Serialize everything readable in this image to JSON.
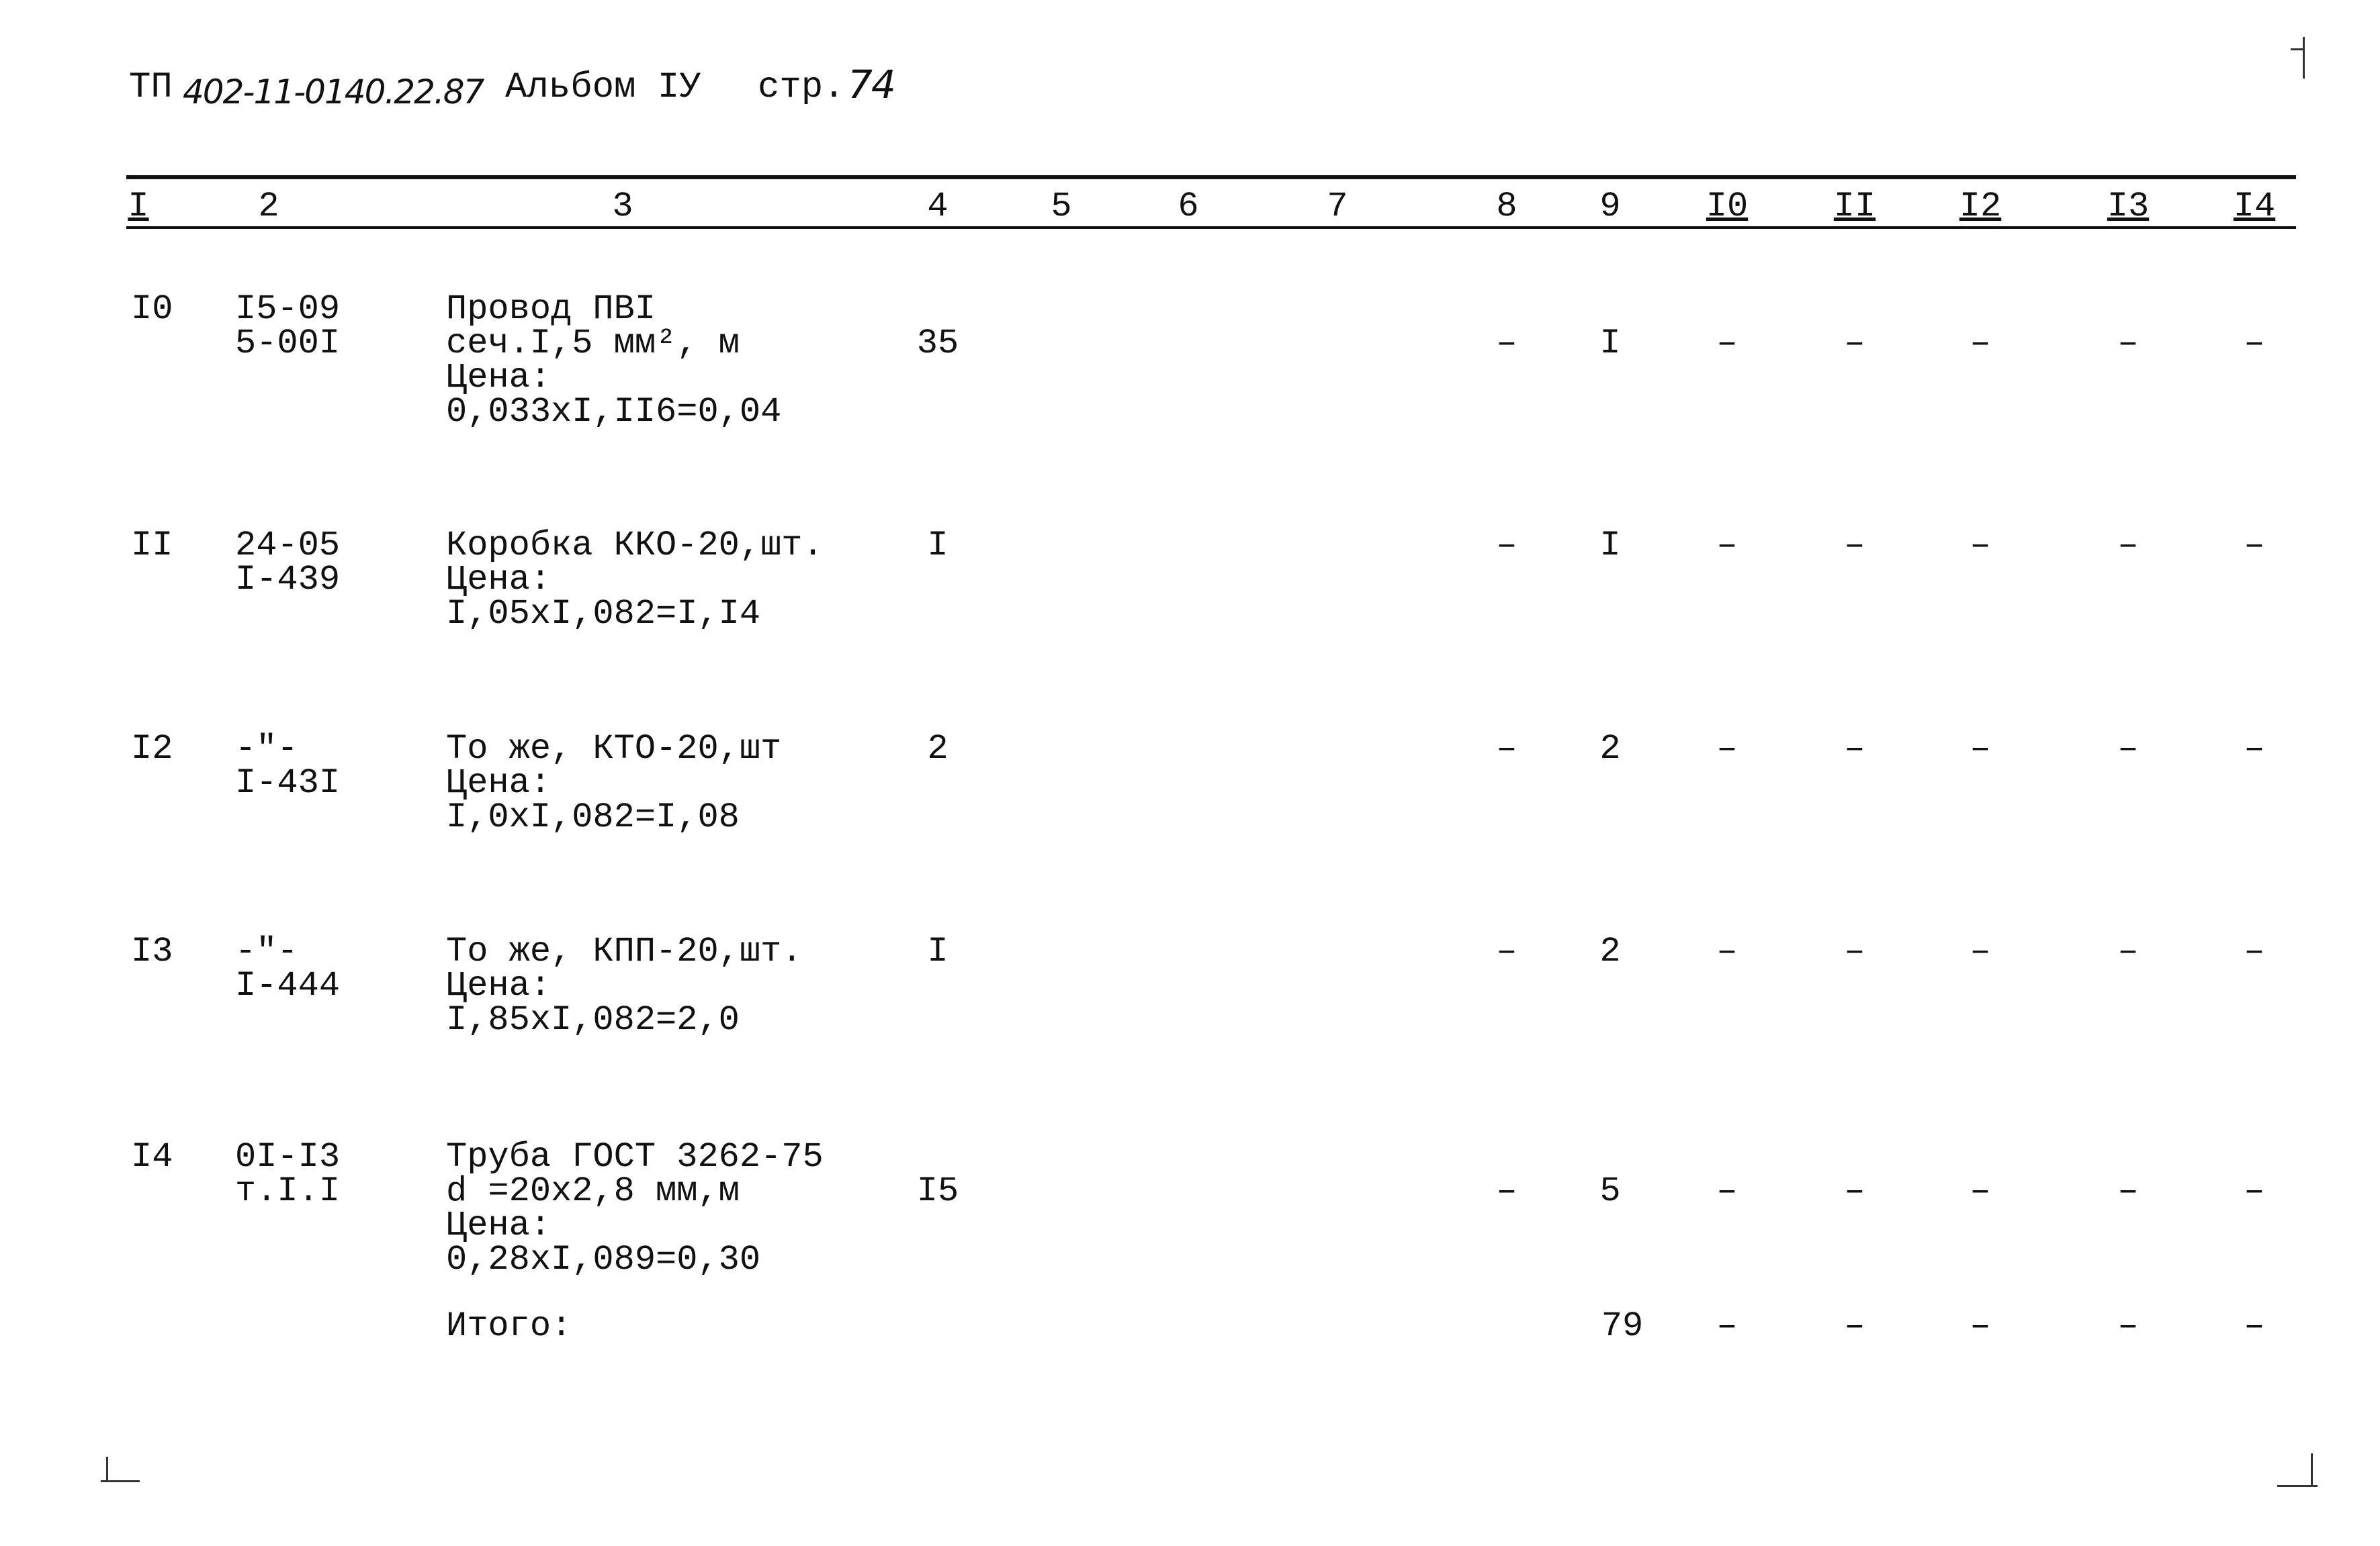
{
  "header": {
    "prefix": "ТП",
    "doc_number": "402-11-0140.22.87",
    "album": "Альбом IУ",
    "page_label": "стр.",
    "page_number": "74"
  },
  "columns": [
    "I",
    "2",
    "3",
    "4",
    "5",
    "6",
    "7",
    "8",
    "9",
    "I0",
    "II",
    "I2",
    "I3",
    "I4"
  ],
  "rows": [
    {
      "num": "I0",
      "code": [
        "I5-09",
        "5-00I"
      ],
      "desc": [
        "Провод ПВI",
        "сеч.I,5 мм², м",
        "Цена:",
        "0,033xI,II6=0,04"
      ],
      "value_line": 1,
      "values": {
        "4": "35",
        "8": "–",
        "9": "I",
        "10": "–",
        "11": "–",
        "12": "–",
        "13": "–",
        "14": "–"
      }
    },
    {
      "num": "II",
      "code": [
        "24-05",
        "I-439"
      ],
      "desc": [
        "Коробка ККО-20,шт.",
        "Цена:",
        "I,05xI,082=I,I4"
      ],
      "value_line": 0,
      "values": {
        "4": "I",
        "8": "–",
        "9": "I",
        "10": "–",
        "11": "–",
        "12": "–",
        "13": "–",
        "14": "–"
      }
    },
    {
      "num": "I2",
      "code": [
        "-\"-",
        "I-43I"
      ],
      "desc": [
        "То же, КТО-20,шт",
        "Цена:",
        "I,0xI,082=I,08"
      ],
      "value_line": 0,
      "values": {
        "4": "2",
        "8": "–",
        "9": "2",
        "10": "–",
        "11": "–",
        "12": "–",
        "13": "–",
        "14": "–"
      }
    },
    {
      "num": "I3",
      "code": [
        "-\"-",
        "I-444"
      ],
      "desc": [
        "То же, КПП-20,шт.",
        "Цена:",
        "I,85xI,082=2,0"
      ],
      "value_line": 0,
      "values": {
        "4": "I",
        "8": "–",
        "9": "2",
        "10": "–",
        "11": "–",
        "12": "–",
        "13": "–",
        "14": "–"
      }
    },
    {
      "num": "I4",
      "code": [
        "0I-I3",
        "т.I.I"
      ],
      "desc": [
        "Труба ГОСТ 3262-75",
        "d =20x2,8 мм,м",
        "Цена:",
        "0,28xI,089=0,30"
      ],
      "value_line": 1,
      "values": {
        "4": "I5",
        "8": "–",
        "9": "5",
        "10": "–",
        "11": "–",
        "12": "–",
        "13": "–",
        "14": "–"
      }
    }
  ],
  "total": {
    "label": "Итого:",
    "values": {
      "9": "79",
      "10": "–",
      "11": "–",
      "12": "–",
      "13": "–",
      "14": "–"
    }
  }
}
